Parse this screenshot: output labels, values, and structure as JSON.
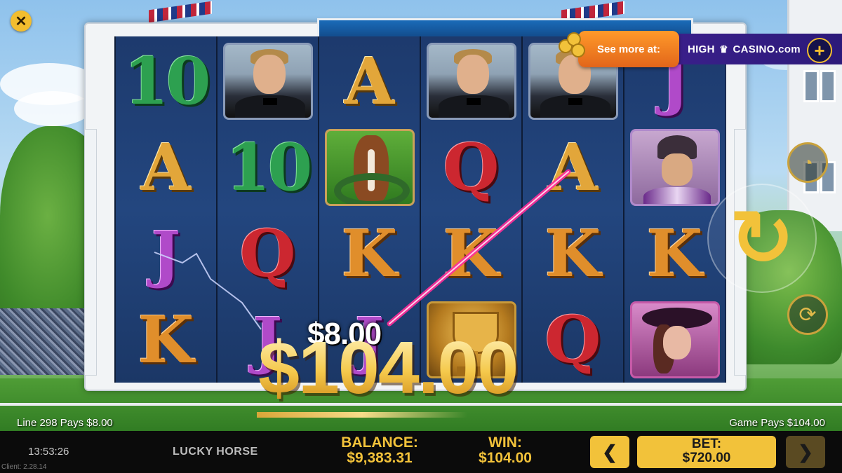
{
  "game": {
    "name": "LUCKY HORSE"
  },
  "reels": [
    [
      "10",
      "A",
      "J",
      "K"
    ],
    [
      "man",
      "10",
      "Q",
      "J"
    ],
    [
      "A",
      "horse",
      "K",
      "J"
    ],
    [
      "man",
      "Q",
      "K",
      "trophy"
    ],
    [
      "man",
      "A",
      "K",
      "Q"
    ],
    [
      "J",
      "jockey",
      "K",
      "lady"
    ]
  ],
  "symbols": {
    "man": "portrait-man-icon",
    "horse": "horse-head-icon",
    "trophy": "trophy-icon",
    "jockey": "jockey-icon",
    "lady": "lady-with-hat-icon"
  },
  "win_overlay": {
    "line_amount": "$8.00",
    "total_amount": "$104.00"
  },
  "promo": {
    "label": "See more at:",
    "brand_left": "HIGH",
    "brand_right": "CASINO.com",
    "plus": "+"
  },
  "status": {
    "line_pays": "Line 298 Pays $8.00",
    "game_pays": "Game Pays $104.00"
  },
  "bottom_bar": {
    "time": "13:53:26",
    "client": "Client: 2.28.14",
    "balance_label": "BALANCE:",
    "balance_value": "$9,383.31",
    "win_label": "WIN:",
    "win_value": "$104.00",
    "bet_label": "BET:",
    "bet_value": "$720.00",
    "prev_glyph": "❮",
    "next_glyph": "❯"
  },
  "controls": {
    "close_glyph": "✕",
    "spin_glyph": "↻",
    "turbo_glyph": "◔",
    "auto_glyph": "⟳"
  },
  "colors": {
    "accent_gold": "#f2c23a",
    "payline": "#ff2e9a",
    "promo_orange": "#f07a20",
    "promo_purple": "#3a1f8a"
  }
}
